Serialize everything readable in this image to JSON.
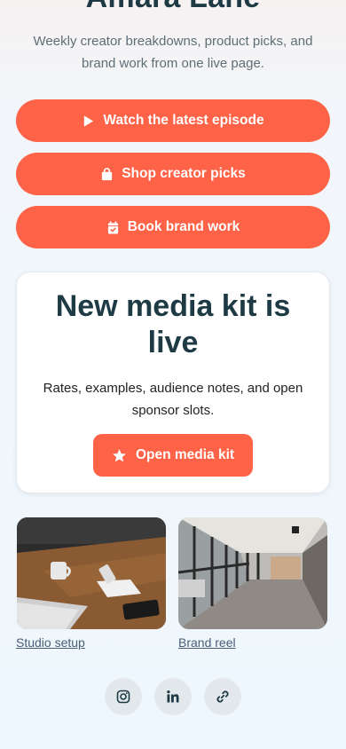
{
  "profile": {
    "name": "Amara Lane",
    "tagline": "Weekly creator breakdowns, product picks, and brand work from one live page."
  },
  "links": [
    {
      "label": "Watch the latest episode",
      "icon": "play-icon"
    },
    {
      "label": "Shop creator picks",
      "icon": "shopping-bag-icon"
    },
    {
      "label": "Book brand work",
      "icon": "calendar-check-icon"
    }
  ],
  "feature_card": {
    "title": "New media kit is live",
    "body": "Rates, examples, audience notes, and open sponsor slots.",
    "button_label": "Open media kit",
    "button_icon": "star-icon"
  },
  "gallery": [
    {
      "caption": "Studio setup",
      "image": "laptop-desk-photo"
    },
    {
      "caption": "Brand reel",
      "image": "office-hallway-photo"
    }
  ],
  "socials": [
    {
      "icon": "instagram-icon"
    },
    {
      "icon": "linkedin-icon"
    },
    {
      "icon": "link-icon"
    }
  ],
  "colors": {
    "accent": "#ff6347",
    "heading": "#1e3a44",
    "muted": "#5f6e75",
    "link": "#4b5c76"
  }
}
